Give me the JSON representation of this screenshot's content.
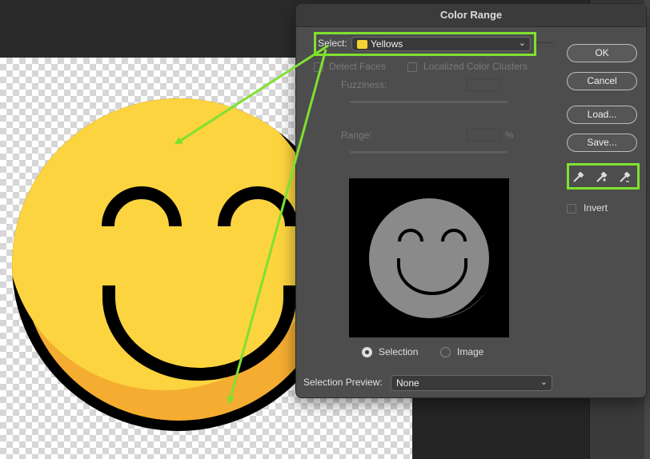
{
  "dialog": {
    "title": "Color Range",
    "select_label": "Select:",
    "select_value": "Yellows",
    "select_swatch_color": "#f5d133",
    "detect_faces_label": "Detect Faces",
    "localized_label": "Localized Color Clusters",
    "fuzziness_label": "Fuzziness:",
    "range_label": "Range:",
    "range_unit": "%",
    "radio_selection_label": "Selection",
    "radio_image_label": "Image",
    "radio_selected": "Selection",
    "preview_label": "Selection Preview:",
    "preview_value": "None",
    "invert_label": "Invert"
  },
  "buttons": {
    "ok": "OK",
    "cancel": "Cancel",
    "load": "Load...",
    "save": "Save..."
  },
  "icons": {
    "eyedropper": "eyedropper-icon",
    "eyedropper_plus": "eyedropper-plus-icon",
    "eyedropper_minus": "eyedropper-minus-icon",
    "chevron": "chevron-down-icon"
  },
  "colors": {
    "highlight": "#7fe12f",
    "smiley_face": "#fcd43f",
    "smiley_shade": "#f5ad31",
    "preview_face": "#8c8c8c"
  }
}
